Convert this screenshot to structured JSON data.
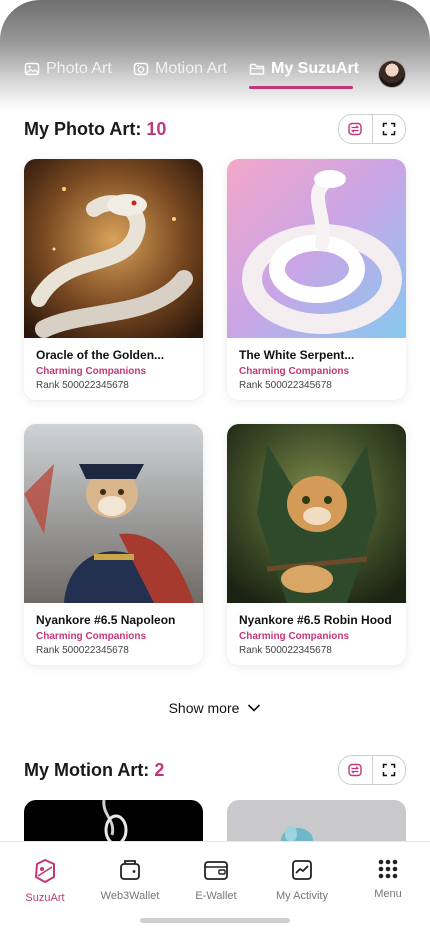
{
  "tabs": [
    {
      "label": "Photo Art",
      "icon": "image-icon"
    },
    {
      "label": "Motion Art",
      "icon": "camera-icon"
    },
    {
      "label": "My SuzuArt",
      "icon": "folder-icon"
    }
  ],
  "photo_section": {
    "title": "My Photo Art:",
    "count": "10",
    "cards": [
      {
        "title": "Oracle of the Golden...",
        "collection": "Charming Companions",
        "rank": "Rank 500022345678"
      },
      {
        "title": "The White Serpent...",
        "collection": "Charming Companions",
        "rank": "Rank 500022345678"
      },
      {
        "title": "Nyankore #6.5 Napoleon",
        "collection": "Charming Companions",
        "rank": "Rank 500022345678"
      },
      {
        "title": "Nyankore #6.5 Robin Hood",
        "collection": "Charming Companions",
        "rank": "Rank 500022345678"
      }
    ],
    "show_more": "Show more"
  },
  "motion_section": {
    "title": "My Motion Art:",
    "count": "2"
  },
  "bottom_nav": [
    {
      "label": "SuzuArt",
      "icon": "suzuart-icon",
      "active": true
    },
    {
      "label": "Web3Wallet",
      "icon": "wallet-icon",
      "active": false
    },
    {
      "label": "E-Wallet",
      "icon": "ewallet-icon",
      "active": false
    },
    {
      "label": "My Activity",
      "icon": "activity-icon",
      "active": false
    },
    {
      "label": "Menu",
      "icon": "grid-icon",
      "active": false
    }
  ],
  "colors": {
    "accent": "#c2377a"
  }
}
